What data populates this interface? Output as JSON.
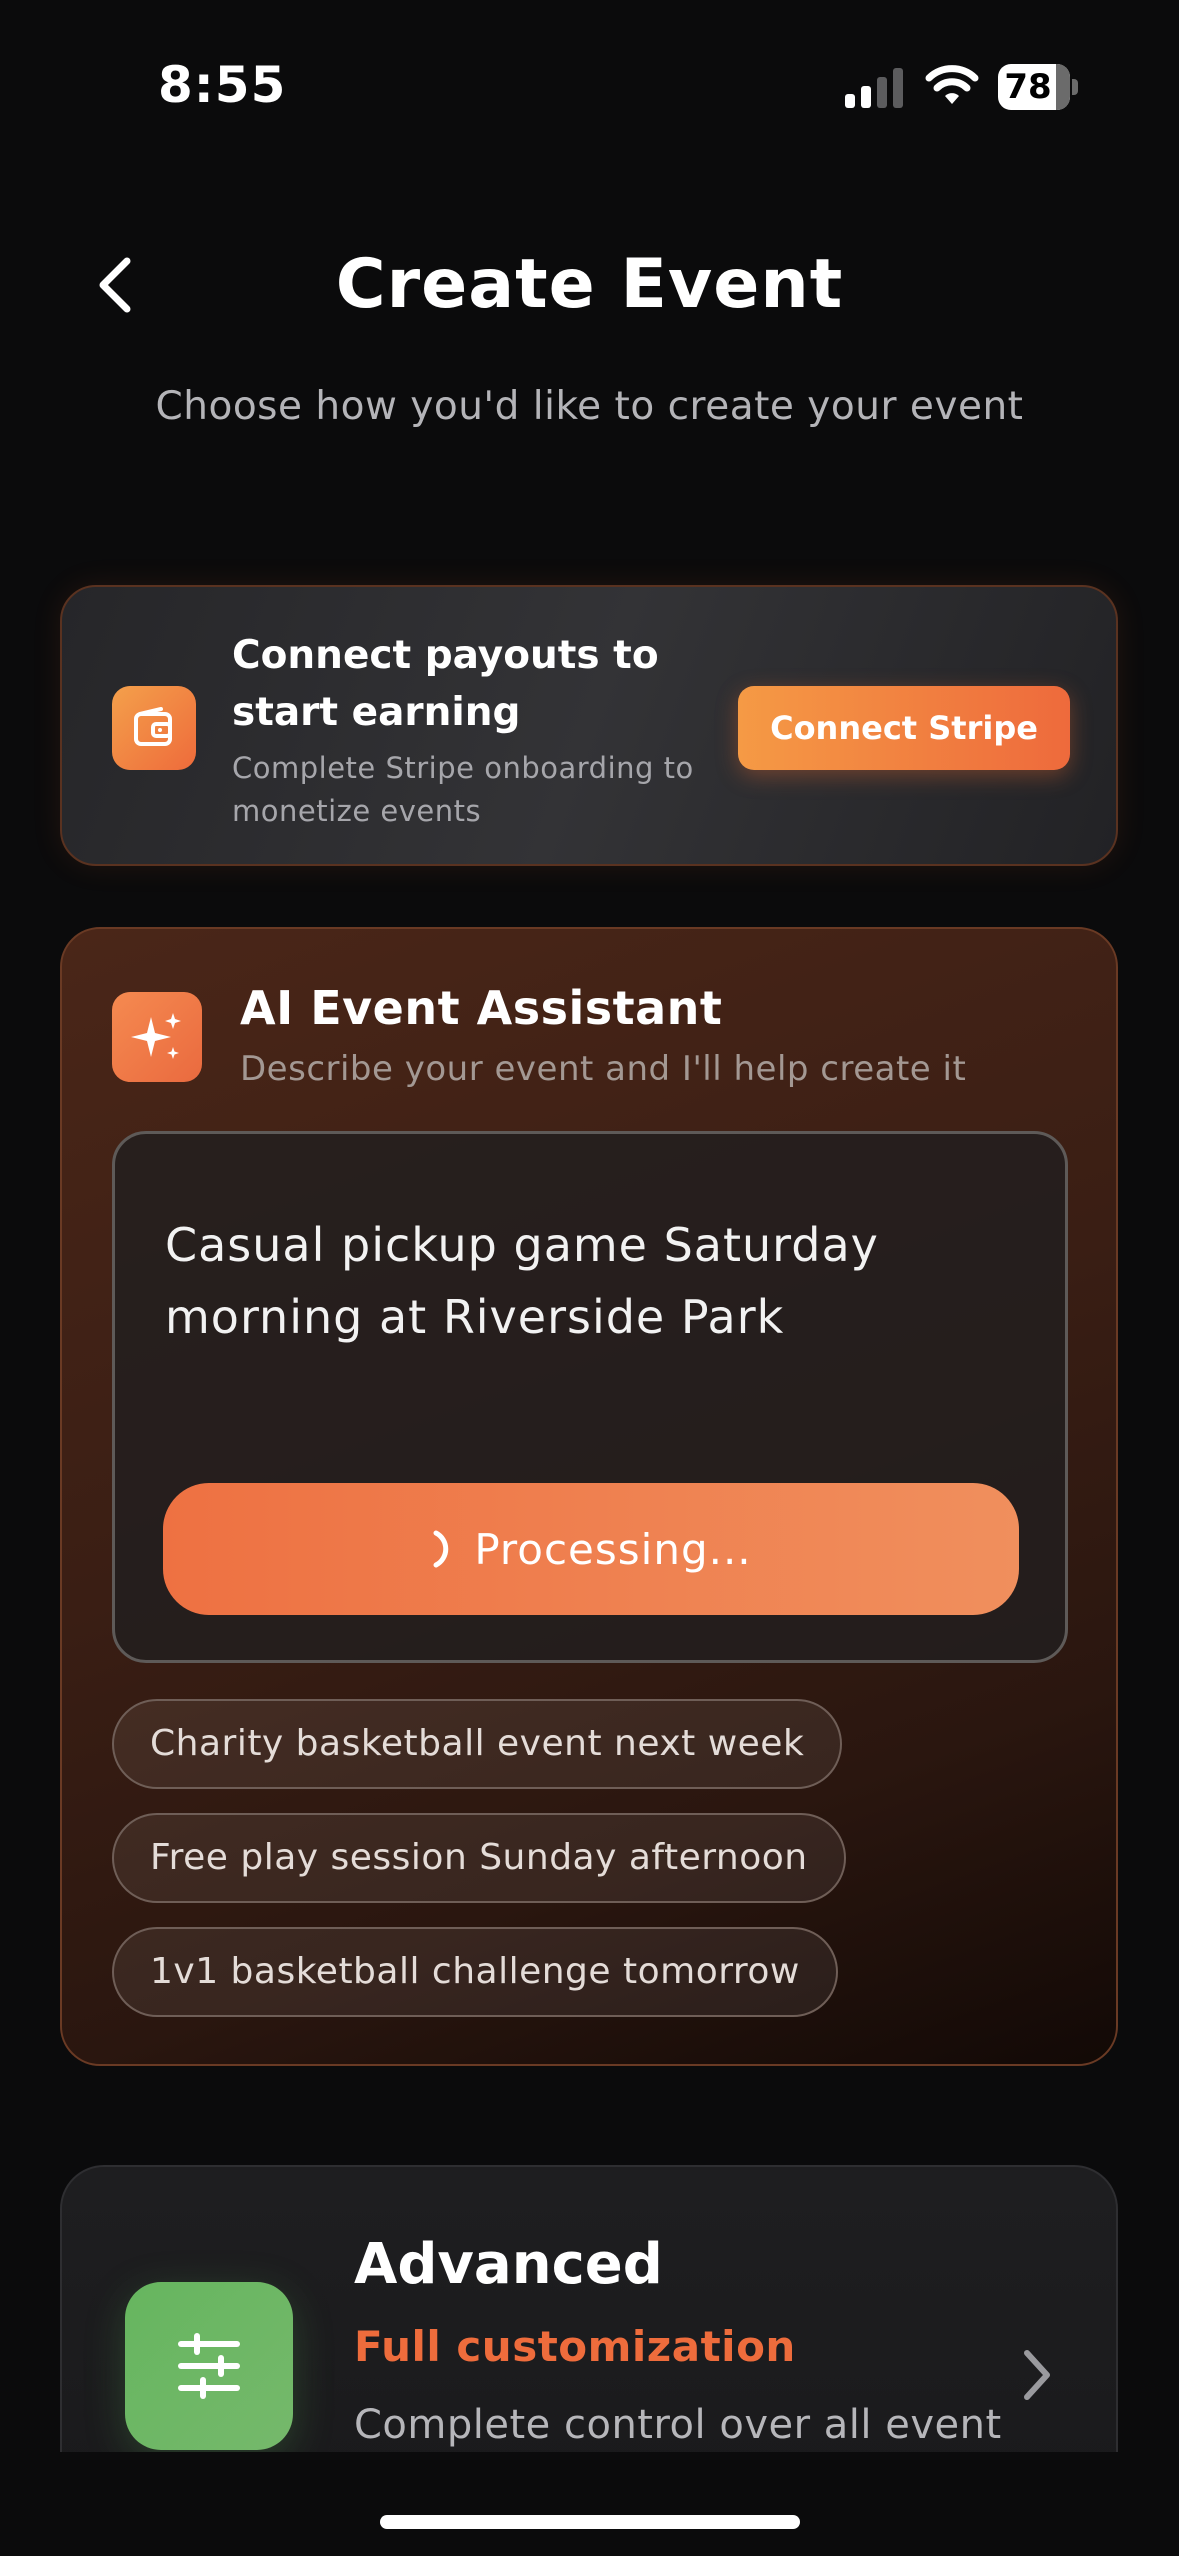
{
  "status_bar": {
    "time": "8:55",
    "battery": "78"
  },
  "header": {
    "title": "Create Event",
    "subtitle": "Choose how you'd like to create your event"
  },
  "stripe_card": {
    "title": "Connect payouts to start earning",
    "description": "Complete Stripe onboarding to monetize events",
    "button_label": "Connect Stripe",
    "icon": "wallet-icon"
  },
  "ai_assistant": {
    "title": "AI Event Assistant",
    "subtitle": "Describe your event and I'll help create it",
    "prompt_value": "Casual pickup game Saturday morning at Riverside Park",
    "button_label": "Processing...",
    "icon": "sparkles-icon",
    "suggestions": [
      {
        "label": "Charity basketball event next week"
      },
      {
        "label": "Free play session Sunday afternoon"
      },
      {
        "label": "1v1 basketball challenge tomorrow"
      }
    ]
  },
  "advanced": {
    "title": "Advanced",
    "tag": "Full customization",
    "description": "Complete control over all event",
    "icon": "sliders-icon"
  },
  "colors": {
    "background": "#0b0b0c",
    "accent_orange": "#ee6c3c",
    "advanced_green": "#6bb563"
  }
}
